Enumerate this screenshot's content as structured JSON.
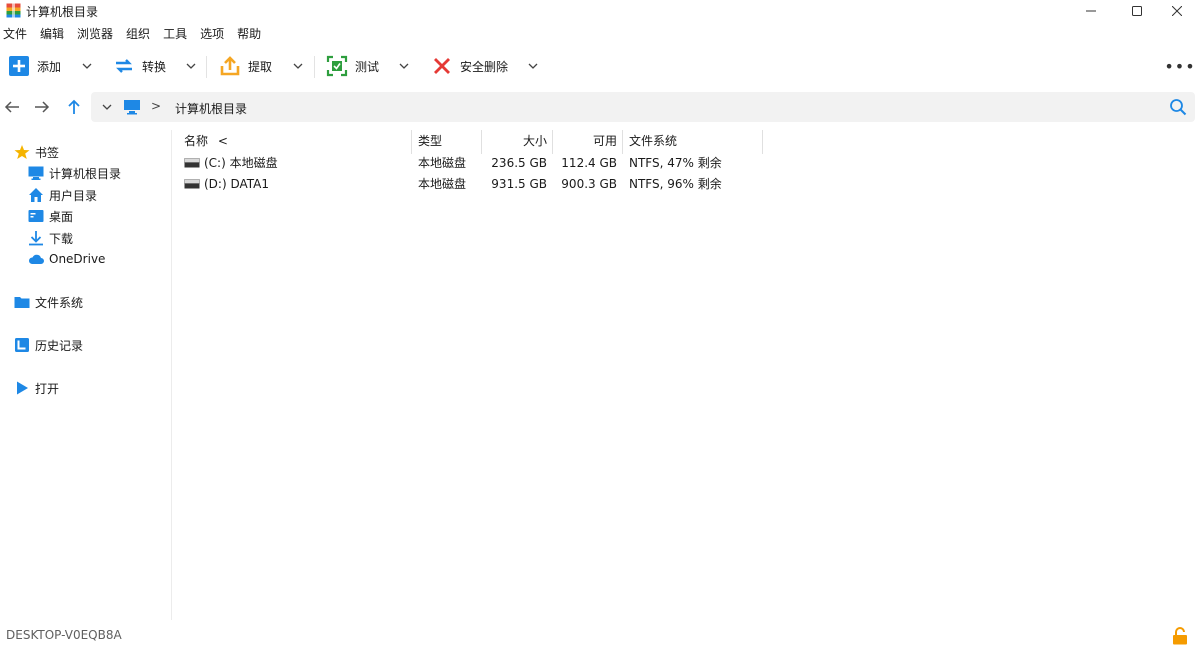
{
  "window": {
    "title": "计算机根目录",
    "icon": "archive-app-icon",
    "controls": [
      "minimize-icon",
      "maximize-icon",
      "close-icon"
    ]
  },
  "menu": [
    "文件",
    "编辑",
    "浏览器",
    "组织",
    "工具",
    "选项",
    "帮助"
  ],
  "toolbar": {
    "add": "添加",
    "convert": "转换",
    "extract": "提取",
    "test": "测试",
    "secure_delete": "安全删除",
    "more": "•••"
  },
  "nav": {
    "back": "back-arrow-icon",
    "forward": "forward-arrow-icon",
    "up": "up-arrow-icon",
    "chevron": ">",
    "path": "计算机根目录"
  },
  "sidebar": {
    "bookmarks": "书签",
    "items": [
      {
        "label": "计算机根目录",
        "icon": "computer-icon"
      },
      {
        "label": "用户目录",
        "icon": "home-icon"
      },
      {
        "label": "桌面",
        "icon": "desktop-icon"
      },
      {
        "label": "下载",
        "icon": "download-icon"
      },
      {
        "label": "OneDrive",
        "icon": "cloud-icon"
      }
    ],
    "filesystem": "文件系统",
    "history": "历史记录",
    "open": "打开"
  },
  "columns": {
    "name": "名称",
    "name_sort": "<",
    "type": "类型",
    "size": "大小",
    "free": "可用",
    "fs": "文件系统"
  },
  "rows": [
    {
      "name": "(C:) 本地磁盘",
      "type": "本地磁盘",
      "size": "236.5 GB",
      "free": "112.4 GB",
      "fs": "NTFS, 47% 剩余"
    },
    {
      "name": "(D:) DATA1",
      "type": "本地磁盘",
      "size": "931.5 GB",
      "free": "900.3 GB",
      "fs": "NTFS, 96% 剩余"
    }
  ],
  "status": {
    "computer": "DESKTOP-V0EQB8A"
  },
  "colors": {
    "accent_blue": "#1e88e5",
    "close_red": "#e53935",
    "extract_orange": "#f5a623",
    "test_green": "#2e9e3e",
    "lock_orange": "#f59b00"
  }
}
